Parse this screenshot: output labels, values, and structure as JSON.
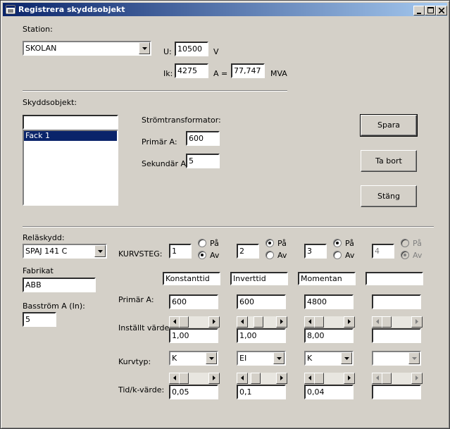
{
  "window": {
    "title": "Registrera skyddsobjekt"
  },
  "station": {
    "label": "Station:",
    "value": "SKOLAN",
    "u_label": "U:",
    "u_value": "10500",
    "u_unit": "V",
    "ik_label": "Ik:",
    "ik_value": "4275",
    "a_eq_label": "A =",
    "mva_value": "77,747",
    "mva_unit": "MVA"
  },
  "skydd": {
    "label": "Skyddsobjekt:",
    "filter_value": "",
    "items": [
      "Fack 1"
    ],
    "ct_label": "Strömtransformator:",
    "prim_label": "Primär A:",
    "prim_value": "600",
    "sek_label": "Sekundär A:",
    "sek_value": "5"
  },
  "buttons": {
    "save": "Spara",
    "delete": "Ta bort",
    "close": "Stäng"
  },
  "rela": {
    "label": "Reläskydd:",
    "value": "SPAJ 141 C",
    "fab_label": "Fabrikat",
    "fab_value": "ABB",
    "bas_label": "Basström A (In):",
    "bas_value": "5"
  },
  "kurv": {
    "kurvsteg_label": "KURVSTEG:",
    "on_label": "På",
    "off_label": "Av",
    "prim_label": "Primär A:",
    "installt_label": "Inställt värde:",
    "kurvtyp_label": "Kurvtyp:",
    "tidk_label": "Tid/k-värde:",
    "steps": [
      {
        "num": "1",
        "state": "Av",
        "name": "Konstanttid",
        "prim": "600",
        "installt": "1,00",
        "kurvtyp": "K",
        "tidk": "0,05"
      },
      {
        "num": "2",
        "state": "På",
        "name": "Inverttid",
        "prim": "600",
        "installt": "1,00",
        "kurvtyp": "EI",
        "tidk": "0,1"
      },
      {
        "num": "3",
        "state": "På",
        "name": "Momentan",
        "prim": "4800",
        "installt": "8,00",
        "kurvtyp": "K",
        "tidk": "0,04"
      },
      {
        "num": "4",
        "state": "Av",
        "name": "",
        "prim": "",
        "installt": "",
        "kurvtyp": "",
        "tidk": ""
      }
    ]
  },
  "colors": {
    "titlebar_start": "#0a246a",
    "titlebar_end": "#a6caf0",
    "face": "#d4d0c8",
    "selection": "#0a246a"
  }
}
